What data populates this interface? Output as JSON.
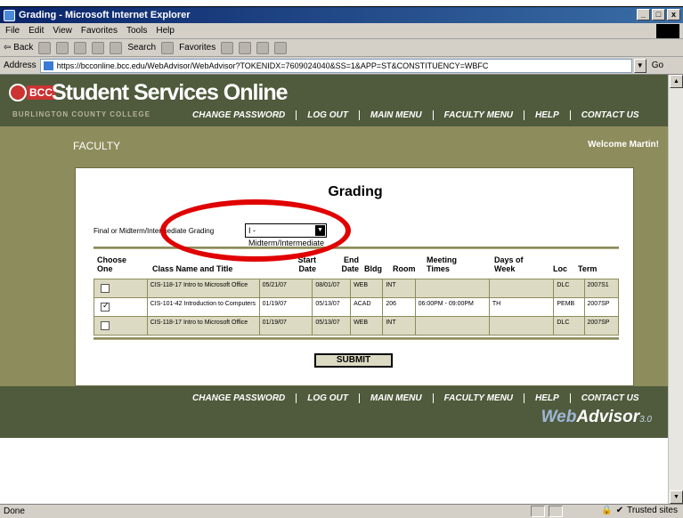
{
  "window": {
    "title": "Grading - Microsoft Internet Explorer",
    "buttons": [
      "_",
      "□",
      "x"
    ]
  },
  "menubar": {
    "items": [
      "File",
      "Edit",
      "View",
      "Favorites",
      "Tools",
      "Help"
    ]
  },
  "toolbar": {
    "back": "⇦ Back",
    "search": "Search",
    "favorites": "Favorites"
  },
  "addressbar": {
    "label": "Address",
    "url": "https://bcconline.bcc.edu/WebAdvisor/WebAdvisor?TOKENIDX=7609024040&SS=1&APP=ST&CONSTITUENCY=WBFC",
    "go": "Go"
  },
  "site": {
    "logo_text": "BCC",
    "title": "Student Services Online",
    "subtitle": "BURLINGTON COUNTY COLLEGE",
    "nav": [
      "CHANGE PASSWORD",
      "LOG OUT",
      "MAIN MENU",
      "FACULTY MENU",
      "HELP",
      "CONTACT US"
    ],
    "section": "FACULTY",
    "welcome": "Welcome Martin!"
  },
  "form": {
    "heading": "Grading",
    "grading_label": "Final or Midterm/Intermediate Grading",
    "grading_value": "I - Midterm/Intermediate",
    "submit": "SUBMIT"
  },
  "table": {
    "headers": {
      "choose": "Choose One",
      "class": "Class Name and Title",
      "start": "Start Date",
      "end": "End Date",
      "bldg": "Bldg",
      "room": "Room",
      "meeting": "Meeting Times",
      "days": "Days of Week",
      "loc": "Loc",
      "term": "Term"
    },
    "rows": [
      {
        "checked": false,
        "class": "CIS-118-17 Intro to Microsoft Office",
        "start": "05/21/07",
        "end": "08/01/07",
        "bldg": "WEB",
        "room": "INT",
        "meeting": "",
        "days": "",
        "loc": "DLC",
        "term": "2007S1"
      },
      {
        "checked": true,
        "class": "CIS-101-42 Introduction to Computers",
        "start": "01/19/07",
        "end": "05/13/07",
        "bldg": "ACAD",
        "room": "206",
        "meeting": "06:00PM - 09:00PM",
        "days": "TH",
        "loc": "PEMB",
        "term": "2007SP"
      },
      {
        "checked": false,
        "class": "CIS-118-17 Intro to Microsoft Office",
        "start": "01/19/07",
        "end": "05/13/07",
        "bldg": "WEB",
        "room": "INT",
        "meeting": "",
        "days": "",
        "loc": "DLC",
        "term": "2007SP"
      }
    ]
  },
  "footer": {
    "brand_web": "Web",
    "brand_advisor": "Advisor",
    "brand_version": "3.0"
  },
  "status": {
    "left": "Done",
    "zone": "Trusted sites"
  },
  "colors": {
    "header": "#4f5b3c",
    "band": "#8d8c5c",
    "highlight": "#e00000"
  }
}
